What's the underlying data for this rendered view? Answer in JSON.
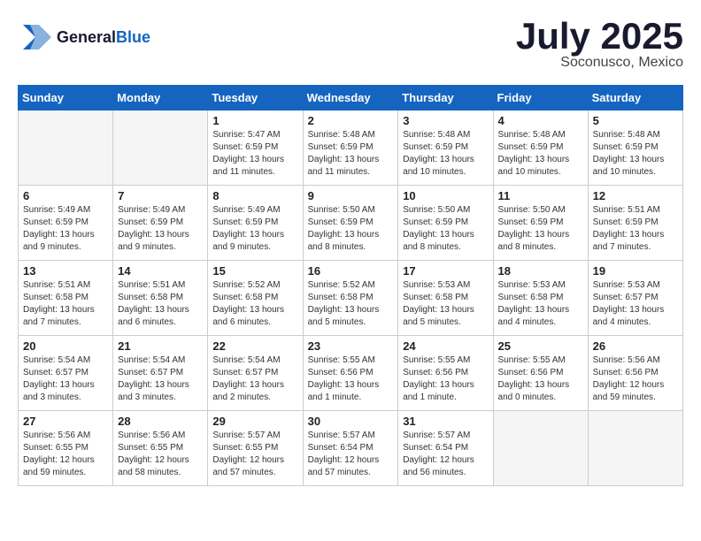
{
  "header": {
    "logo_line1": "General",
    "logo_line2": "Blue",
    "month": "July 2025",
    "location": "Soconusco, Mexico"
  },
  "weekdays": [
    "Sunday",
    "Monday",
    "Tuesday",
    "Wednesday",
    "Thursday",
    "Friday",
    "Saturday"
  ],
  "weeks": [
    [
      {
        "day": "",
        "info": ""
      },
      {
        "day": "",
        "info": ""
      },
      {
        "day": "1",
        "info": "Sunrise: 5:47 AM\nSunset: 6:59 PM\nDaylight: 13 hours and 11 minutes."
      },
      {
        "day": "2",
        "info": "Sunrise: 5:48 AM\nSunset: 6:59 PM\nDaylight: 13 hours and 11 minutes."
      },
      {
        "day": "3",
        "info": "Sunrise: 5:48 AM\nSunset: 6:59 PM\nDaylight: 13 hours and 10 minutes."
      },
      {
        "day": "4",
        "info": "Sunrise: 5:48 AM\nSunset: 6:59 PM\nDaylight: 13 hours and 10 minutes."
      },
      {
        "day": "5",
        "info": "Sunrise: 5:48 AM\nSunset: 6:59 PM\nDaylight: 13 hours and 10 minutes."
      }
    ],
    [
      {
        "day": "6",
        "info": "Sunrise: 5:49 AM\nSunset: 6:59 PM\nDaylight: 13 hours and 9 minutes."
      },
      {
        "day": "7",
        "info": "Sunrise: 5:49 AM\nSunset: 6:59 PM\nDaylight: 13 hours and 9 minutes."
      },
      {
        "day": "8",
        "info": "Sunrise: 5:49 AM\nSunset: 6:59 PM\nDaylight: 13 hours and 9 minutes."
      },
      {
        "day": "9",
        "info": "Sunrise: 5:50 AM\nSunset: 6:59 PM\nDaylight: 13 hours and 8 minutes."
      },
      {
        "day": "10",
        "info": "Sunrise: 5:50 AM\nSunset: 6:59 PM\nDaylight: 13 hours and 8 minutes."
      },
      {
        "day": "11",
        "info": "Sunrise: 5:50 AM\nSunset: 6:59 PM\nDaylight: 13 hours and 8 minutes."
      },
      {
        "day": "12",
        "info": "Sunrise: 5:51 AM\nSunset: 6:59 PM\nDaylight: 13 hours and 7 minutes."
      }
    ],
    [
      {
        "day": "13",
        "info": "Sunrise: 5:51 AM\nSunset: 6:58 PM\nDaylight: 13 hours and 7 minutes."
      },
      {
        "day": "14",
        "info": "Sunrise: 5:51 AM\nSunset: 6:58 PM\nDaylight: 13 hours and 6 minutes."
      },
      {
        "day": "15",
        "info": "Sunrise: 5:52 AM\nSunset: 6:58 PM\nDaylight: 13 hours and 6 minutes."
      },
      {
        "day": "16",
        "info": "Sunrise: 5:52 AM\nSunset: 6:58 PM\nDaylight: 13 hours and 5 minutes."
      },
      {
        "day": "17",
        "info": "Sunrise: 5:53 AM\nSunset: 6:58 PM\nDaylight: 13 hours and 5 minutes."
      },
      {
        "day": "18",
        "info": "Sunrise: 5:53 AM\nSunset: 6:58 PM\nDaylight: 13 hours and 4 minutes."
      },
      {
        "day": "19",
        "info": "Sunrise: 5:53 AM\nSunset: 6:57 PM\nDaylight: 13 hours and 4 minutes."
      }
    ],
    [
      {
        "day": "20",
        "info": "Sunrise: 5:54 AM\nSunset: 6:57 PM\nDaylight: 13 hours and 3 minutes."
      },
      {
        "day": "21",
        "info": "Sunrise: 5:54 AM\nSunset: 6:57 PM\nDaylight: 13 hours and 3 minutes."
      },
      {
        "day": "22",
        "info": "Sunrise: 5:54 AM\nSunset: 6:57 PM\nDaylight: 13 hours and 2 minutes."
      },
      {
        "day": "23",
        "info": "Sunrise: 5:55 AM\nSunset: 6:56 PM\nDaylight: 13 hours and 1 minute."
      },
      {
        "day": "24",
        "info": "Sunrise: 5:55 AM\nSunset: 6:56 PM\nDaylight: 13 hours and 1 minute."
      },
      {
        "day": "25",
        "info": "Sunrise: 5:55 AM\nSunset: 6:56 PM\nDaylight: 13 hours and 0 minutes."
      },
      {
        "day": "26",
        "info": "Sunrise: 5:56 AM\nSunset: 6:56 PM\nDaylight: 12 hours and 59 minutes."
      }
    ],
    [
      {
        "day": "27",
        "info": "Sunrise: 5:56 AM\nSunset: 6:55 PM\nDaylight: 12 hours and 59 minutes."
      },
      {
        "day": "28",
        "info": "Sunrise: 5:56 AM\nSunset: 6:55 PM\nDaylight: 12 hours and 58 minutes."
      },
      {
        "day": "29",
        "info": "Sunrise: 5:57 AM\nSunset: 6:55 PM\nDaylight: 12 hours and 57 minutes."
      },
      {
        "day": "30",
        "info": "Sunrise: 5:57 AM\nSunset: 6:54 PM\nDaylight: 12 hours and 57 minutes."
      },
      {
        "day": "31",
        "info": "Sunrise: 5:57 AM\nSunset: 6:54 PM\nDaylight: 12 hours and 56 minutes."
      },
      {
        "day": "",
        "info": ""
      },
      {
        "day": "",
        "info": ""
      }
    ]
  ]
}
